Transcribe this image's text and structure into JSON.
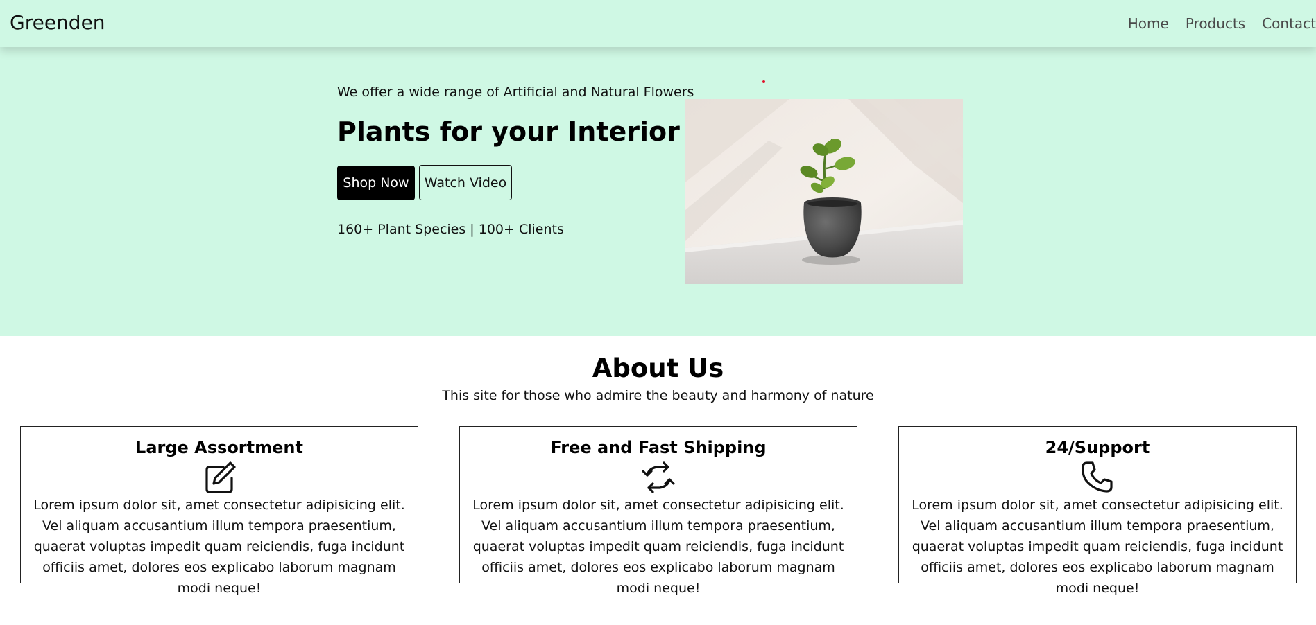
{
  "nav": {
    "brand": "Greenden",
    "links": [
      "Home",
      "Products",
      "Contact"
    ]
  },
  "hero": {
    "subtitle": "We offer a wide range of Artificial and Natural Flowers",
    "title": "Plants for your Interior",
    "primary_button": "Shop Now",
    "secondary_button": "Watch Video",
    "stats": "160+ Plant Species | 100+ Clients",
    "background_color": "#cff8e4"
  },
  "about": {
    "title": "About Us",
    "subtitle": "This site for those who admire the beauty and harmony of nature"
  },
  "features": [
    {
      "title": "Large Assortment",
      "icon": "pencil-square-icon",
      "text": "Lorem ipsum dolor sit, amet consectetur adipisicing elit. Vel aliquam accusantium illum tempora praesentium, quaerat voluptas impedit quam reiciendis, fuga incidunt officiis amet, dolores eos explicabo laborum magnam modi neque!"
    },
    {
      "title": "Free and Fast Shipping",
      "icon": "refresh-arrows-icon",
      "text": "Lorem ipsum dolor sit, amet consectetur adipisicing elit. Vel aliquam accusantium illum tempora praesentium, quaerat voluptas impedit quam reiciendis, fuga incidunt officiis amet, dolores eos explicabo laborum magnam modi neque!"
    },
    {
      "title": "24/Support",
      "icon": "phone-icon",
      "text": "Lorem ipsum dolor sit, amet consectetur adipisicing elit. Vel aliquam accusantium illum tempora praesentium, quaerat voluptas impedit quam reiciendis, fuga incidunt officiis amet, dolores eos explicabo laborum magnam modi neque!"
    }
  ]
}
